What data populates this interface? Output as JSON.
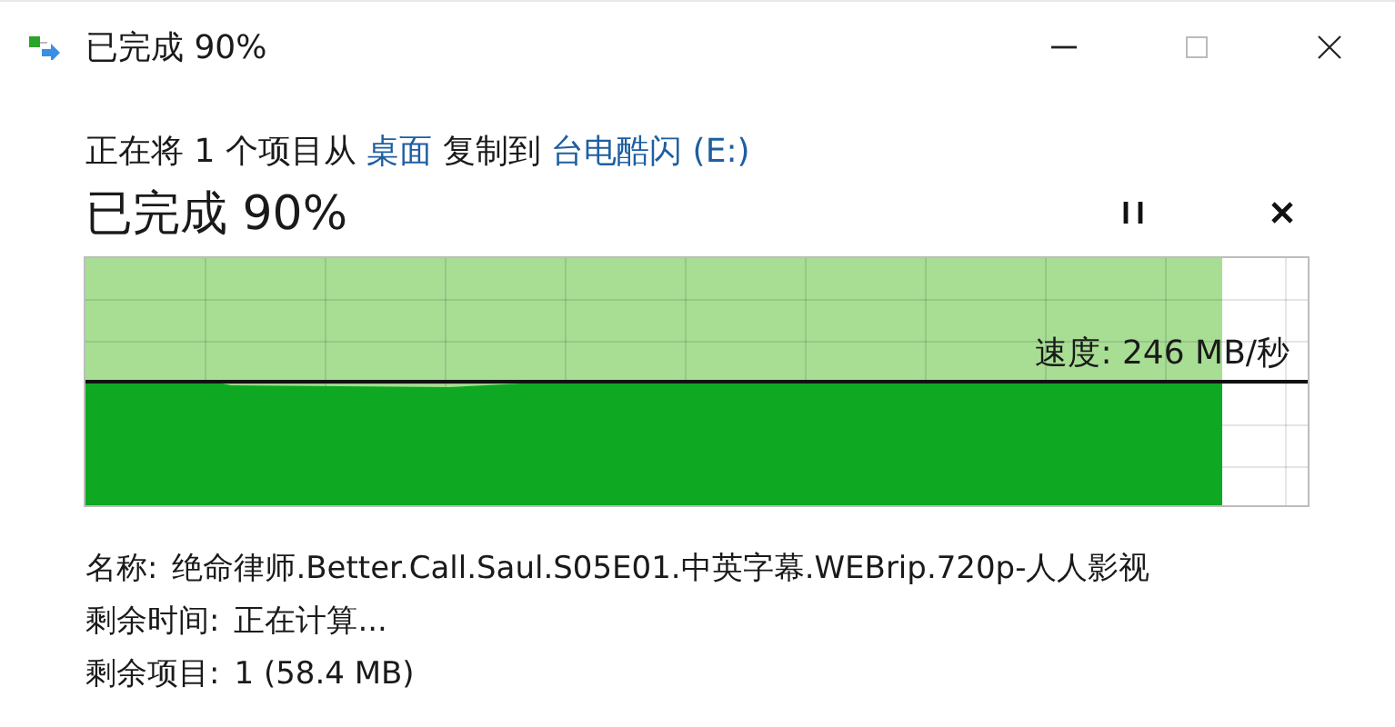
{
  "window": {
    "title": "已完成 90%"
  },
  "description": {
    "prefix": "正在将 1 个项目从",
    "source": "桌面",
    "middle": "复制到",
    "destination": "台电酷闪 (E:)"
  },
  "heading": "已完成 90%",
  "progress": {
    "level": 0.93,
    "speed": "速度: 246 MB/秒"
  },
  "details": [
    {
      "label": "名称:",
      "value": "绝命律师.Better.Call.Saul.S05E01.中英字幕.WEBrip.720p-人人影视"
    },
    {
      "label": "剩余时间:",
      "value": "正在计算..."
    },
    {
      "label": "剩余项目:",
      "value": "1 (58.4 MB)"
    }
  ]
}
